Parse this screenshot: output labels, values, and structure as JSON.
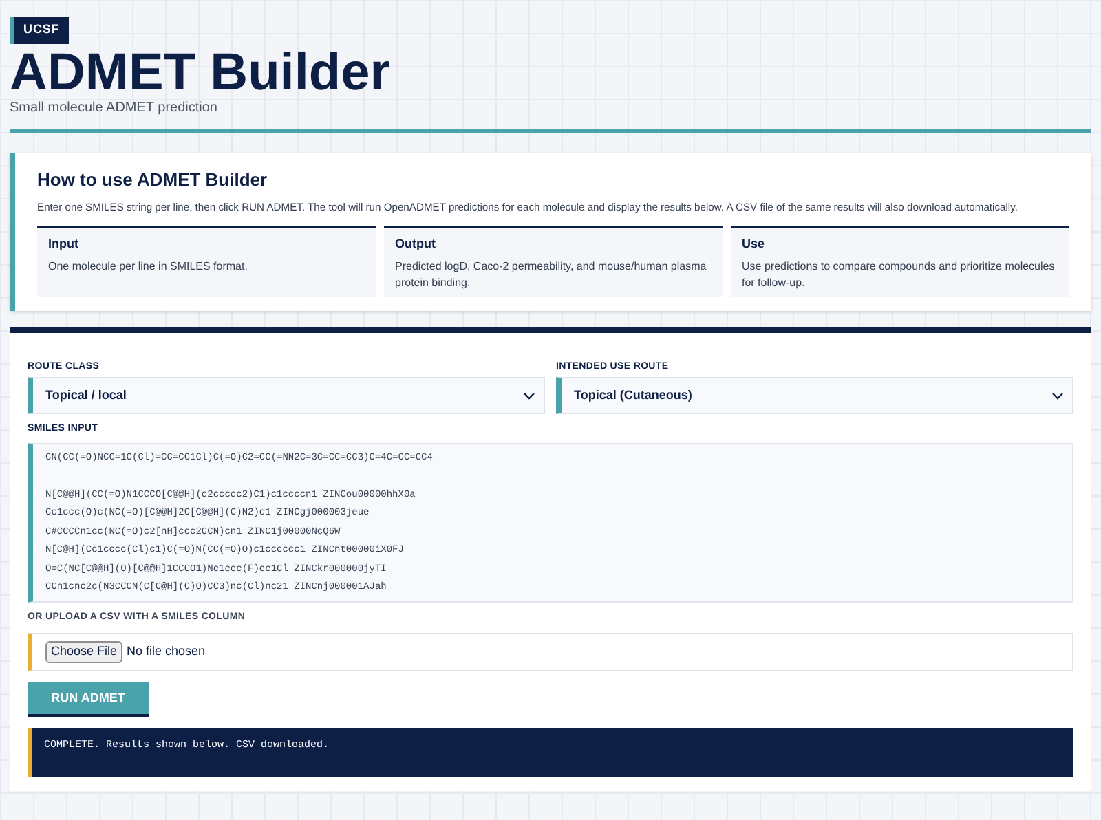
{
  "header": {
    "badge": "UCSF",
    "title": "ADMET Builder",
    "subtitle": "Small molecule ADMET prediction"
  },
  "howto": {
    "title": "How to use ADMET Builder",
    "intro": "Enter one SMILES string per line, then click RUN ADMET. The tool will run OpenADMET predictions for each molecule and display the results below. A CSV file of the same results will also download automatically.",
    "cards": [
      {
        "title": "Input",
        "text": "One molecule per line in SMILES format."
      },
      {
        "title": "Output",
        "text": "Predicted logD, Caco-2 permeability, and mouse/human plasma protein binding."
      },
      {
        "title": "Use",
        "text": "Use predictions to compare compounds and prioritize molecules for follow-up."
      }
    ]
  },
  "form": {
    "selects": [
      {
        "label": "ROUTE CLASS",
        "value": "Topical / local"
      },
      {
        "label": "INTENDED USE ROUTE",
        "value": "Topical (Cutaneous)"
      }
    ],
    "smiles_label": "SMILES INPUT",
    "smiles_value": "CN(CC(=O)NCC=1C(Cl)=CC=CC1Cl)C(=O)C2=CC(=NN2C=3C=CC=CC3)C=4C=CC=CC4\n\nN[C@@H](CC(=O)N1CCCO[C@@H](c2ccccc2)C1)c1ccccn1 ZINCou00000hhX0a\nCc1ccc(O)c(NC(=O)[C@@H]2C[C@@H](C)N2)c1 ZINCgj000003jeue\nC#CCCCn1cc(NC(=O)c2[nH]ccc2CCN)cn1 ZINC1j00000NcQ6W\nN[C@H](Cc1cccc(Cl)c1)C(=O)N(CC(=O)O)c1cccccc1 ZINCnt00000iX0FJ\nO=C(NC[C@@H](O)[C@@H]1CCCO1)Nc1ccc(F)cc1Cl ZINCkr000000jyTI\nCCn1cnc2c(N3CCCN(C[C@H](C)O)CC3)nc(Cl)nc21 ZINCnj000001AJah",
    "upload_label": "OR UPLOAD A CSV WITH A SMILES COLUMN",
    "file_button": "Choose File",
    "file_status": "No file chosen",
    "run_button": "RUN ADMET",
    "status": "COMPLETE. Results shown below. CSV downloaded."
  }
}
